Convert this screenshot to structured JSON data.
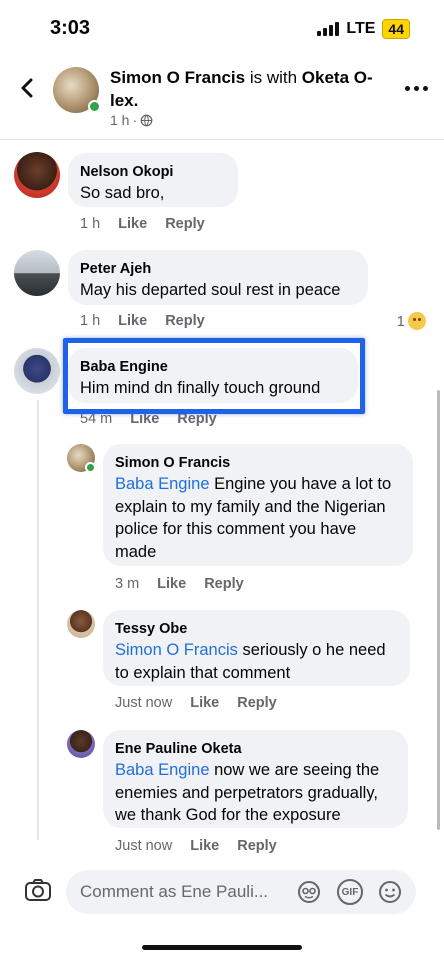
{
  "status_bar": {
    "time": "3:03",
    "network": "LTE",
    "battery": "44"
  },
  "post": {
    "author": "Simon O Francis",
    "is_with_text": "is with",
    "tagged": "Oketa O-lex.",
    "time": "1 h",
    "privacy_icon": "globe-icon"
  },
  "comments": [
    {
      "name": "Nelson Okopi",
      "text": "So sad bro,",
      "time": "1 h",
      "like": "Like",
      "reply": "Reply"
    },
    {
      "name": "Peter Ajeh",
      "text": "May his departed soul rest in peace",
      "time": "1 h",
      "like": "Like",
      "reply": "Reply",
      "reaction_count": "1"
    },
    {
      "name": "Baba Engine",
      "text": "Him mind dn finally touch ground",
      "time": "54 m",
      "like": "Like",
      "reply": "Reply"
    }
  ],
  "replies": [
    {
      "name": "Simon O Francis",
      "mention": "Baba Engine",
      "text": " Engine you have a lot to explain to my family and the Nigerian police for this comment you have made",
      "time": "3 m",
      "like": "Like",
      "reply": "Reply"
    },
    {
      "name": "Tessy Obe",
      "mention": "Simon O Francis",
      "text": " seriously o he need to explain that comment",
      "time": "Just now",
      "like": "Like",
      "reply": "Reply"
    },
    {
      "name": "Ene Pauline Oketa",
      "mention": "Baba Engine",
      "text": " now we are seeing the enemies and perpetrators gradually, we thank God for the exposure",
      "time": "Just now",
      "like": "Like",
      "reply": "Reply"
    }
  ],
  "composer": {
    "placeholder": "Comment as Ene Pauli...",
    "gif_label": "GIF"
  },
  "colors": {
    "mention": "#216fdb",
    "highlight": "#1f62e8",
    "bubble": "#f0f2f5",
    "online": "#31a24c"
  }
}
